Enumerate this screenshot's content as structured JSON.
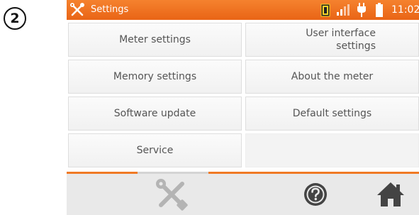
{
  "step_badge": "2",
  "titlebar": {
    "title": "Settings",
    "app_icon": "wrench-screwdriver-icon",
    "status_icons": [
      "battery-indicator-icon",
      "signal-bars-icon",
      "power-plug-icon",
      "battery-icon"
    ],
    "clock": "11:02"
  },
  "menu": {
    "meter_settings": "Meter settings",
    "user_interface_line1": "User interface",
    "user_interface_line2": "settings",
    "memory_settings": "Memory settings",
    "about_meter": "About the meter",
    "software_update": "Software update",
    "default_settings": "Default settings",
    "service": "Service"
  },
  "bottombar": {
    "icons": [
      "settings-tools-icon",
      "help-icon",
      "home-icon"
    ]
  },
  "colors": {
    "accent": "#f07a25",
    "titlebar": "#ee6e1f"
  }
}
